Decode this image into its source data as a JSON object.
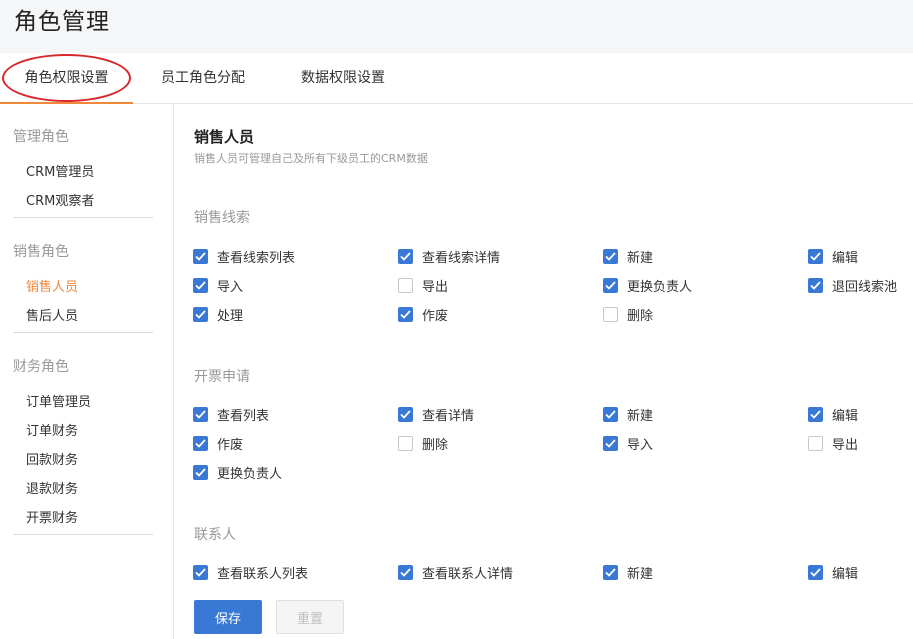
{
  "page": {
    "title": "角色管理"
  },
  "tabs": [
    {
      "label": "角色权限设置",
      "active": true
    },
    {
      "label": "员工角色分配",
      "active": false
    },
    {
      "label": "数据权限设置",
      "active": false
    }
  ],
  "sidebar": {
    "groups": [
      {
        "title": "管理角色",
        "items": [
          {
            "label": "CRM管理员",
            "active": false
          },
          {
            "label": "CRM观察者",
            "active": false
          }
        ]
      },
      {
        "title": "销售角色",
        "items": [
          {
            "label": "销售人员",
            "active": true
          },
          {
            "label": "售后人员",
            "active": false
          }
        ]
      },
      {
        "title": "财务角色",
        "items": [
          {
            "label": "订单管理员",
            "active": false
          },
          {
            "label": "订单财务",
            "active": false
          },
          {
            "label": "回款财务",
            "active": false
          },
          {
            "label": "退款财务",
            "active": false
          },
          {
            "label": "开票财务",
            "active": false
          }
        ]
      }
    ]
  },
  "role": {
    "name": "销售人员",
    "description": "销售人员可管理自己及所有下级员工的CRM数据"
  },
  "sections": [
    {
      "title": "销售线索",
      "permissions": [
        {
          "label": "查看线索列表",
          "checked": true
        },
        {
          "label": "查看线索详情",
          "checked": true
        },
        {
          "label": "新建",
          "checked": true
        },
        {
          "label": "编辑",
          "checked": true
        },
        {
          "label": "导入",
          "checked": true
        },
        {
          "label": "导出",
          "checked": false
        },
        {
          "label": "更换负责人",
          "checked": true
        },
        {
          "label": "退回线索池",
          "checked": true
        },
        {
          "label": "处理",
          "checked": true
        },
        {
          "label": "作废",
          "checked": true
        },
        {
          "label": "删除",
          "checked": false
        }
      ]
    },
    {
      "title": "开票申请",
      "permissions": [
        {
          "label": "查看列表",
          "checked": true
        },
        {
          "label": "查看详情",
          "checked": true
        },
        {
          "label": "新建",
          "checked": true
        },
        {
          "label": "编辑",
          "checked": true
        },
        {
          "label": "作废",
          "checked": true
        },
        {
          "label": "删除",
          "checked": false
        },
        {
          "label": "导入",
          "checked": true
        },
        {
          "label": "导出",
          "checked": false
        },
        {
          "label": "更换负责人",
          "checked": true
        }
      ]
    },
    {
      "title": "联系人",
      "permissions": [
        {
          "label": "查看联系人列表",
          "checked": true
        },
        {
          "label": "查看联系人详情",
          "checked": true
        },
        {
          "label": "新建",
          "checked": true
        },
        {
          "label": "编辑",
          "checked": true
        }
      ]
    }
  ],
  "actions": {
    "save_label": "保存",
    "reset_label": "重置"
  },
  "colors": {
    "accent": "#f0883a",
    "primary": "#3a78d6",
    "annotation": "#d9262b"
  }
}
